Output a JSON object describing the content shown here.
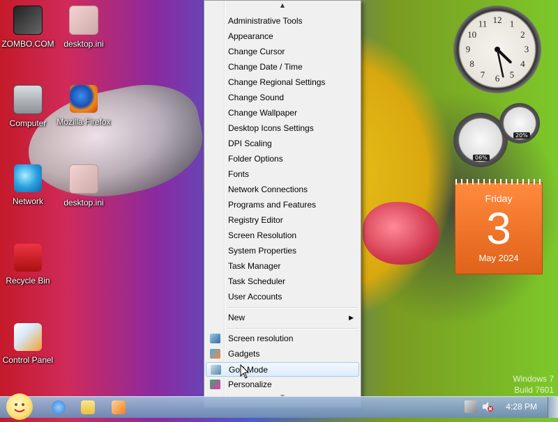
{
  "desktop": {
    "icons": [
      {
        "label": "ZOMBO.COM",
        "icon": "zombo-icon"
      },
      {
        "label": "desktop.ini",
        "icon": "ini-file-icon"
      },
      {
        "label": "Computer",
        "icon": "computer-icon"
      },
      {
        "label": "Mozilla Firefox",
        "icon": "firefox-icon"
      },
      {
        "label": "Network",
        "icon": "network-icon"
      },
      {
        "label": "desktop.ini",
        "icon": "ini-file-icon"
      },
      {
        "label": "Recycle Bin",
        "icon": "recycle-bin-icon"
      },
      {
        "label": "Control Panel",
        "icon": "control-panel-icon"
      }
    ],
    "watermark": {
      "line1": "Windows 7",
      "line2": "Build 7601"
    }
  },
  "gadgets": {
    "clock": {
      "hour": 4,
      "minute": 28,
      "numbers": [
        "12",
        "1",
        "2",
        "3",
        "4",
        "5",
        "6",
        "7",
        "8",
        "9",
        "10",
        "11"
      ]
    },
    "meter": {
      "cpu": "06%",
      "memory": "20%"
    },
    "calendar": {
      "day": "Friday",
      "date": "3",
      "month": "May 2024"
    }
  },
  "context_menu": {
    "items": [
      {
        "label": "Administrative Tools"
      },
      {
        "label": "Appearance"
      },
      {
        "label": "Change Cursor"
      },
      {
        "label": "Change Date / Time"
      },
      {
        "label": "Change Regional Settings"
      },
      {
        "label": "Change Sound"
      },
      {
        "label": "Change Wallpaper"
      },
      {
        "label": "Desktop Icons Settings"
      },
      {
        "label": "DPI Scaling"
      },
      {
        "label": "Folder Options"
      },
      {
        "label": "Fonts"
      },
      {
        "label": "Network Connections"
      },
      {
        "label": "Programs and Features"
      },
      {
        "label": "Registry Editor"
      },
      {
        "label": "Screen Resolution"
      },
      {
        "label": "System Properties"
      },
      {
        "label": "Task Manager"
      },
      {
        "label": "Task Scheduler"
      },
      {
        "label": "User Accounts"
      }
    ],
    "new_label": "New",
    "bottom_items": [
      {
        "label": "Screen resolution",
        "icon": "display-icon"
      },
      {
        "label": "Gadgets",
        "icon": "gadgets-icon"
      },
      {
        "label": "God Mode",
        "icon": "god-mode-icon",
        "highlighted": true
      },
      {
        "label": "Personalize",
        "icon": "personalize-icon"
      }
    ]
  },
  "taskbar": {
    "pinned": [
      {
        "name": "internet-explorer-icon",
        "color": "#2a7fd4"
      },
      {
        "name": "windows-explorer-icon",
        "color": "#e8c040"
      },
      {
        "name": "media-player-icon",
        "color": "#f08020"
      }
    ],
    "time": "4:28 PM"
  },
  "colors": {
    "accent_menu_highlight": "#dcebfc",
    "calendar": "#e0621a",
    "taskbar": "#8aa4c8"
  }
}
